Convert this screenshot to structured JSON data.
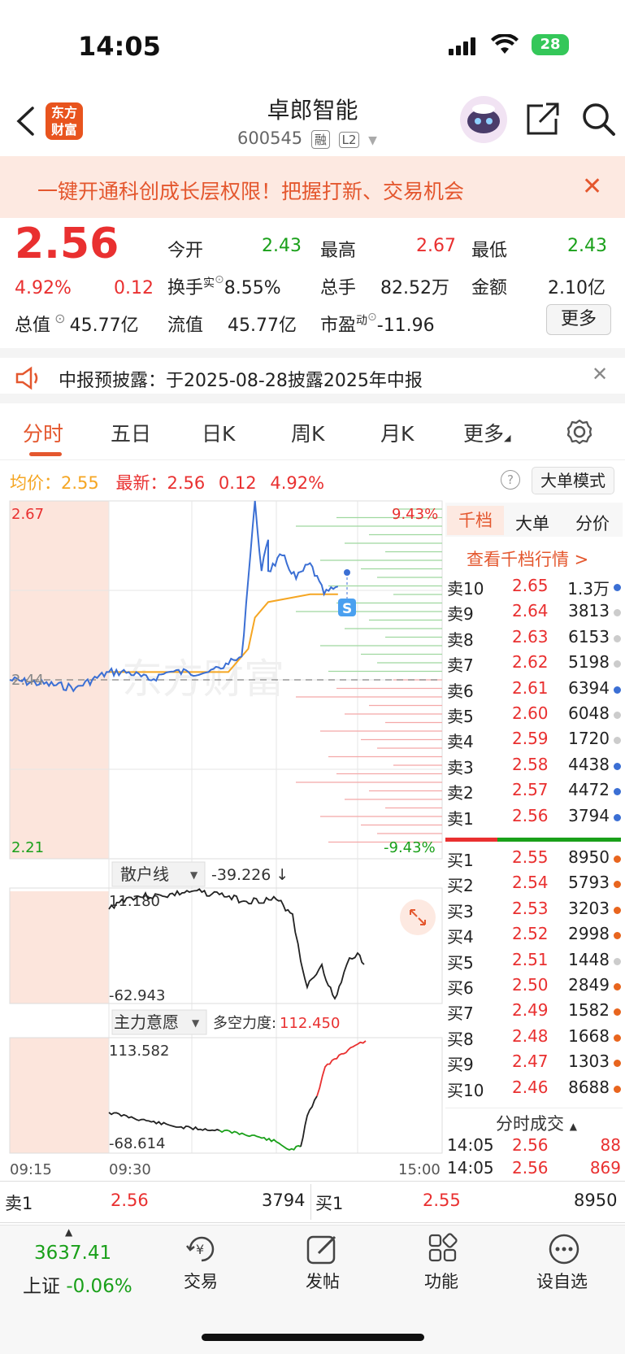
{
  "status_bar": {
    "time": "14:05",
    "battery": "28"
  },
  "nav": {
    "logo_text_1": "东方",
    "logo_text_2": "财富",
    "stock_name": "卓郎智能",
    "stock_code": "600545",
    "tag_rong": "融",
    "tag_l2": "L2"
  },
  "banner": {
    "text": "一键开通科创成长层权限！把握打新、交易机会"
  },
  "quote": {
    "price": "2.56",
    "change_pct": "4.92%",
    "change": "0.12",
    "open_label": "今开",
    "open": "2.43",
    "high_label": "最高",
    "high": "2.67",
    "low_label": "最低",
    "low": "2.43",
    "turnover_label": "换手",
    "turnover_sup": "实",
    "turnover": "8.55%",
    "volume_label": "总手",
    "volume": "82.52万",
    "amount_label": "金额",
    "amount": "2.10亿",
    "mktcap_label": "总值",
    "mktcap": "45.77亿",
    "float_label": "流值",
    "float_cap": "45.77亿",
    "pe_label": "市盈",
    "pe_sup": "动",
    "pe": "-11.96",
    "more": "更多"
  },
  "notice": {
    "text": "中报预披露：于2025-08-28披露2025年中报"
  },
  "tabs": [
    "分时",
    "五日",
    "日K",
    "周K",
    "月K",
    "更多"
  ],
  "avg_bar": {
    "avg_label": "均价：",
    "avg": "2.55",
    "latest_label": "最新：",
    "latest": "2.56",
    "change": "0.12",
    "pct": "4.92%",
    "mode_button": "大单模式"
  },
  "chart": {
    "y_high": "2.67",
    "y_low": "2.21",
    "y_prev": "2.44",
    "pct_high": "9.43%",
    "pct_low": "-9.43%",
    "watermark": "东方财富",
    "t_start": "09:15",
    "t_open": "09:30",
    "t_end": "15:00",
    "marker": "S",
    "retail_label": "散户线",
    "retail_value": "-39.226 ↓",
    "retail_max": "11.180",
    "retail_min": "-62.943",
    "main_label": "主力意愿",
    "main_force_label": "多空力度:",
    "main_force": "112.450",
    "main_max": "113.582",
    "main_min": "-68.614"
  },
  "chart_data": {
    "type": "line",
    "title": "",
    "x_range": [
      "09:15",
      "15:00"
    ],
    "ylim": [
      2.21,
      2.67
    ],
    "prev_close": 2.44,
    "series": [
      {
        "name": "",
        "x": [
          "09:15",
          "09:25",
          "09:30",
          "09:45",
          "10:00",
          "10:15",
          "10:30",
          "10:45",
          "11:00",
          "11:10",
          "11:15",
          "11:20",
          "11:25",
          "11:30",
          "13:00",
          "13:10",
          "13:20",
          "13:30",
          "13:40",
          "13:50"
        ],
        "values": [
          2.44,
          2.43,
          2.45,
          2.45,
          2.44,
          2.45,
          2.45,
          2.45,
          2.46,
          2.47,
          2.57,
          2.67,
          2.58,
          2.62,
          2.58,
          2.6,
          2.57,
          2.59,
          2.55,
          2.56
        ]
      },
      {
        "name": "均价",
        "x": [
          "09:30",
          "10:00",
          "10:30",
          "11:00",
          "11:15",
          "11:20",
          "11:30",
          "13:00",
          "13:30",
          "13:50"
        ],
        "values": [
          2.45,
          2.45,
          2.45,
          2.45,
          2.48,
          2.52,
          2.54,
          2.54,
          2.55,
          2.55
        ]
      }
    ]
  },
  "orderbook": {
    "tabs": [
      "千档",
      "大单",
      "分价"
    ],
    "link": "查看千档行情 >",
    "asks": [
      {
        "label": "卖10",
        "price": "2.65",
        "vol": "1.3万",
        "dot": "#3b6fd4"
      },
      {
        "label": "卖9",
        "price": "2.64",
        "vol": "3813",
        "dot": "#cccccc"
      },
      {
        "label": "卖8",
        "price": "2.63",
        "vol": "6153",
        "dot": "#cccccc"
      },
      {
        "label": "卖7",
        "price": "2.62",
        "vol": "5198",
        "dot": "#cccccc"
      },
      {
        "label": "卖6",
        "price": "2.61",
        "vol": "6394",
        "dot": "#3b6fd4"
      },
      {
        "label": "卖5",
        "price": "2.60",
        "vol": "6048",
        "dot": "#cccccc"
      },
      {
        "label": "卖4",
        "price": "2.59",
        "vol": "1720",
        "dot": "#cccccc"
      },
      {
        "label": "卖3",
        "price": "2.58",
        "vol": "4438",
        "dot": "#3b6fd4"
      },
      {
        "label": "卖2",
        "price": "2.57",
        "vol": "4472",
        "dot": "#3b6fd4"
      },
      {
        "label": "卖1",
        "price": "2.56",
        "vol": "3794",
        "dot": "#3b6fd4"
      }
    ],
    "bids": [
      {
        "label": "买1",
        "price": "2.55",
        "vol": "8950",
        "dot": "#e8651e"
      },
      {
        "label": "买2",
        "price": "2.54",
        "vol": "5793",
        "dot": "#e8651e"
      },
      {
        "label": "买3",
        "price": "2.53",
        "vol": "3203",
        "dot": "#e8651e"
      },
      {
        "label": "买4",
        "price": "2.52",
        "vol": "2998",
        "dot": "#e8651e"
      },
      {
        "label": "买5",
        "price": "2.51",
        "vol": "1448",
        "dot": "#cccccc"
      },
      {
        "label": "买6",
        "price": "2.50",
        "vol": "2849",
        "dot": "#e8651e"
      },
      {
        "label": "买7",
        "price": "2.49",
        "vol": "1582",
        "dot": "#e8651e"
      },
      {
        "label": "买8",
        "price": "2.48",
        "vol": "1668",
        "dot": "#e8651e"
      },
      {
        "label": "买9",
        "price": "2.47",
        "vol": "1303",
        "dot": "#e8651e"
      },
      {
        "label": "买10",
        "price": "2.46",
        "vol": "8688",
        "dot": "#e8651e"
      }
    ],
    "ticks_label": "分时成交",
    "ticks": [
      {
        "time": "14:05",
        "price": "2.56",
        "vol": "88"
      },
      {
        "time": "14:05",
        "price": "2.56",
        "vol": "869"
      }
    ]
  },
  "level1": {
    "ask_label": "卖1",
    "ask_price": "2.56",
    "ask_vol": "3794",
    "bid_label": "买1",
    "bid_price": "2.55",
    "bid_vol": "8950"
  },
  "bottom": {
    "index_value": "3637.41",
    "index_name": "上证",
    "index_pct": "-0.06%",
    "trade": "交易",
    "post": "发帖",
    "func": "功能",
    "watch": "设自选"
  }
}
